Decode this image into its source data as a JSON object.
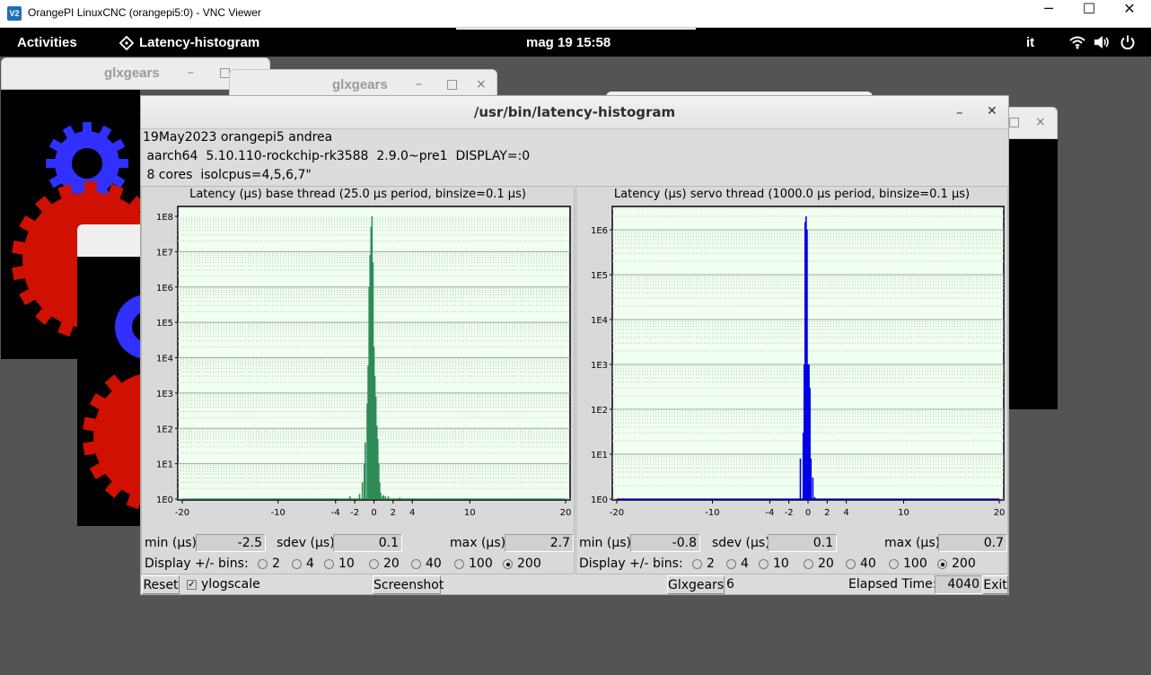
{
  "vnc": {
    "title": "OrangePI LinuxCNC (orangepi5:0) - VNC Viewer",
    "logo": "V2",
    "minimize": "─",
    "maximize": "☐",
    "close": "✕"
  },
  "topbar": {
    "activities": "Activities",
    "app_name": "Latency-histogram",
    "clock": "mag 19  15:58",
    "language": "it"
  },
  "bg_windows": {
    "glx1_title": "glxgears",
    "glx2_title": "glxgears",
    "min": "–",
    "max": "□",
    "close": "×"
  },
  "window": {
    "title": "/usr/bin/latency-histogram",
    "min": "–",
    "close": "✕"
  },
  "sysinfo": {
    "line1": "19May2023 orangepi5 andrea",
    "line2": " aarch64  5.10.110-rockchip-rk3588  2.9.0~pre1  DISPLAY=:0",
    "line3": " 8 cores  isolcpus=4,5,6,7\""
  },
  "base": {
    "title": "Latency (µs) base thread (25.0 µs period, binsize=0.1 µs)",
    "min_label": "min (µs)",
    "min_value": "-2.5",
    "sdev_label": "sdev (µs)",
    "sdev_value": "0.1",
    "max_label": "max (µs)",
    "max_value": "2.7",
    "display_label": "Display +/- bins:",
    "bins": [
      "2",
      "4",
      "10",
      "20",
      "40",
      "100",
      "200"
    ],
    "selected_bin": "200"
  },
  "servo": {
    "title": "Latency (µs) servo thread (1000.0 µs period, binsize=0.1 µs)",
    "min_label": "min (µs)",
    "min_value": "-0.8",
    "sdev_label": "sdev (µs)",
    "sdev_value": "0.1",
    "max_label": "max (µs)",
    "max_value": "0.7",
    "display_label": "Display +/- bins:",
    "bins": [
      "2",
      "4",
      "10",
      "20",
      "40",
      "100",
      "200"
    ],
    "selected_bin": "200"
  },
  "bottom": {
    "reset": "Reset",
    "ylogscale": "ylogscale",
    "ylogscale_checked": true,
    "screenshot": "Screenshot",
    "glxgears": "Glxgears",
    "glxgears_count": "6",
    "elapsed_label": "Elapsed Time:",
    "elapsed_value": "4040",
    "exit": "Exit"
  },
  "colors": {
    "base_bar": "#2e8b57",
    "servo_bar": "#0000e6",
    "plot_bg": "#f0fff0",
    "gear_blue": "#3030ff",
    "gear_red": "#d01000"
  },
  "chart_data": [
    {
      "type": "bar",
      "title": "Latency (µs) base thread (25.0 µs period, binsize=0.1 µs)",
      "xlabel": "",
      "ylabel": "",
      "xlim": [
        -20,
        20
      ],
      "ylim": [
        1,
        100000000
      ],
      "log_y": true,
      "grid": true,
      "x_ticks": [
        -20,
        -10,
        -4,
        -2,
        0,
        2,
        4,
        10,
        20
      ],
      "y_ticks": [
        "1E0",
        "1E1",
        "1E2",
        "1E3",
        "1E4",
        "1E5",
        "1E6",
        "1E7",
        "1E8"
      ],
      "x": [
        -2.5,
        -1.5,
        -1.2,
        -1.0,
        -0.9,
        -0.7,
        -0.6,
        -0.5,
        -0.4,
        -0.3,
        -0.2,
        -0.1,
        0.0,
        0.1,
        0.2,
        0.3,
        0.4,
        0.5,
        0.6,
        0.7,
        0.9,
        1.0,
        1.2,
        1.5,
        2.7
      ],
      "values": [
        1.2,
        1.4,
        3,
        10,
        40,
        500,
        6000,
        1000000,
        8000000,
        50000000,
        100000000,
        5000000,
        20000,
        3000,
        800,
        120,
        50,
        10,
        3,
        1.5,
        1.2,
        1.3,
        1.2,
        1.2,
        1.1
      ],
      "bar_color": "#2e8b57"
    },
    {
      "type": "bar",
      "title": "Latency (µs) servo thread (1000.0 µs period, binsize=0.1 µs)",
      "xlabel": "",
      "ylabel": "",
      "xlim": [
        -20,
        20
      ],
      "ylim": [
        1,
        2000000
      ],
      "log_y": true,
      "grid": true,
      "x_ticks": [
        -20,
        -10,
        -4,
        -2,
        0,
        2,
        4,
        10,
        20
      ],
      "y_ticks": [
        "1E0",
        "1E1",
        "1E2",
        "1E3",
        "1E4",
        "1E5",
        "1E6"
      ],
      "x": [
        -0.8,
        -0.5,
        -0.4,
        -0.3,
        -0.2,
        -0.1,
        0.0,
        0.1,
        0.2,
        0.3,
        0.5,
        0.7
      ],
      "values": [
        8,
        30,
        1000,
        1500000,
        2000000,
        1000000,
        1000,
        1000,
        300,
        8,
        3,
        1.1
      ],
      "bar_color": "#0000e6"
    }
  ]
}
